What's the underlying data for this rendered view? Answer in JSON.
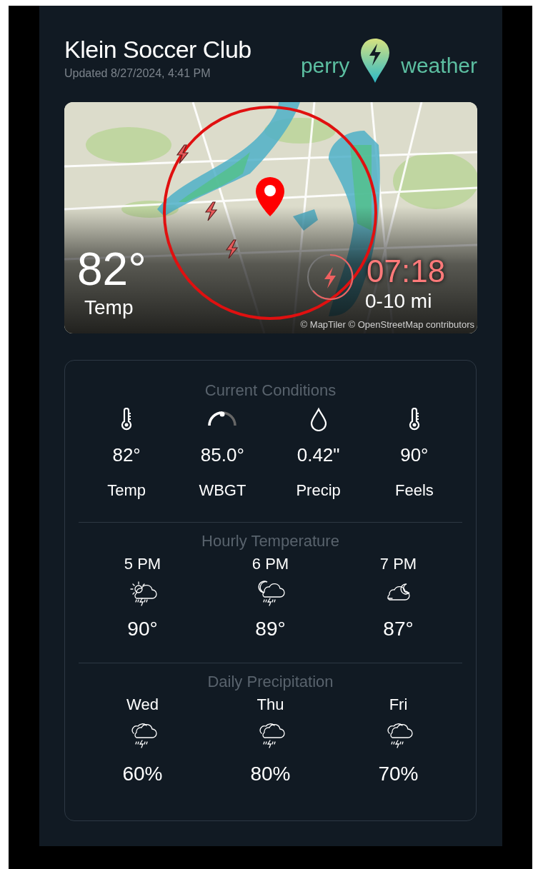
{
  "header": {
    "title": "Klein Soccer Club",
    "updated": "Updated 8/27/2024, 4:41 PM",
    "logo": {
      "left": "perry",
      "right": "weather"
    }
  },
  "map": {
    "temp": "82°",
    "temp_label": "Temp",
    "countdown": "07:18",
    "range": "0-10 mi",
    "attribution": "© MapTiler © OpenStreetMap contributors"
  },
  "current": {
    "title": "Current Conditions",
    "items": [
      {
        "kind": "thermometer",
        "value": "82°",
        "label": "Temp"
      },
      {
        "kind": "gauge",
        "value": "85.0°",
        "label": "WBGT"
      },
      {
        "kind": "drop",
        "value": "0.42\"",
        "label": "Precip"
      },
      {
        "kind": "thermometer",
        "value": "90°",
        "label": "Feels"
      }
    ]
  },
  "hourly": {
    "title": "Hourly Temperature",
    "items": [
      {
        "time": "5 PM",
        "kind": "day-storm",
        "temp": "90°"
      },
      {
        "time": "6 PM",
        "kind": "night-storm",
        "temp": "89°"
      },
      {
        "time": "7 PM",
        "kind": "night-cloudy",
        "temp": "87°"
      }
    ]
  },
  "daily": {
    "title": "Daily Precipitation",
    "items": [
      {
        "day": "Wed",
        "kind": "storm",
        "chance": "60%"
      },
      {
        "day": "Thu",
        "kind": "storm",
        "chance": "80%"
      },
      {
        "day": "Fri",
        "kind": "storm",
        "chance": "70%"
      }
    ]
  }
}
